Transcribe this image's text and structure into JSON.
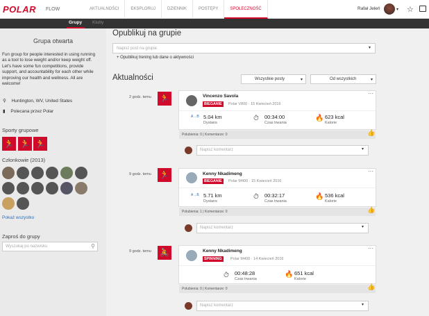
{
  "header": {
    "logo": "POLAR",
    "product": "FLOW",
    "nav": [
      "AKTUALNOŚCI",
      "EKSPLORUJ",
      "DZIENNIK",
      "POSTĘPY",
      "SPOŁECZNOŚĆ"
    ],
    "active": "SPOŁECZNOŚĆ",
    "user_name": "Rafał Jeleń",
    "caret": "▾",
    "star": "☆"
  },
  "subnav": {
    "tabs": [
      "Grupy",
      "Kluby"
    ],
    "active": "Grupy"
  },
  "sidebar": {
    "title": "Grupa otwarta",
    "description": "Fun group for people interested in using running as a tool to lose weight and/or keep weight off. Let's have some fun competitions, provide support, and accountability for each other while improving our health and wellness. All are welcome!",
    "location": "Huntington, WV, United States",
    "recommended": "Polecana przez Polar",
    "sports_title": "Sporty grupowe",
    "members_title": "Członkowie (2013)",
    "show_all": "Pokaż wszystko",
    "invite_title": "Zaproś do grupy",
    "invite_placeholder": "Wyszukaj po nazwisku"
  },
  "main": {
    "title": "Opublikuj na grupie",
    "post_placeholder": "Napisz post na grupie",
    "post_link": "+ Opublikuj trening lub dane o aktywności",
    "feed_title": "Aktualności",
    "filter1": "Wszystkie posty",
    "filter2": "Od wszystkich",
    "dots": "···",
    "thumb": "👍",
    "comment_placeholder": "Napisz komentarz",
    "posts": [
      {
        "time": "2 godz. temu",
        "name": "Vincenzo Savola",
        "sport": "BIEGANIE",
        "device": "Polar V800",
        "date": "15 Kwiecień 2016",
        "s1": "5.04 km",
        "l1": "Dystans",
        "s2": "00:34:00",
        "l2": "Czas trwania",
        "s3": "623 kcal",
        "l3": "Kalorie",
        "likes": "Polubienia: 0 | Komentarze: 0"
      },
      {
        "time": "9 godz. temu",
        "name": "Kenny Nkadimeng",
        "sport": "BIEGANIE",
        "device": "Polar M400",
        "date": "15 Kwiecień 2016",
        "s1": "5.71 km",
        "l1": "Dystans",
        "s2": "00:32:17",
        "l2": "Czas trwania",
        "s3": "536 kcal",
        "l3": "Kalorie",
        "likes": "Polubienia: 1 | Komentarze: 0"
      },
      {
        "time": "9 godz. temu",
        "name": "Kenny Nkadimeng",
        "sport": "SPINNING",
        "device": "Polar M400",
        "date": "14 Kwiecień 2016",
        "s2": "00:48:28",
        "l2": "Czas trwania",
        "s3": "651 kcal",
        "l3": "Kalorie",
        "likes": "Polubienia: 0 | Komentarze: 0"
      }
    ]
  },
  "colors": {
    "accent": "#d10a2b",
    "link": "#2a6ebb"
  }
}
